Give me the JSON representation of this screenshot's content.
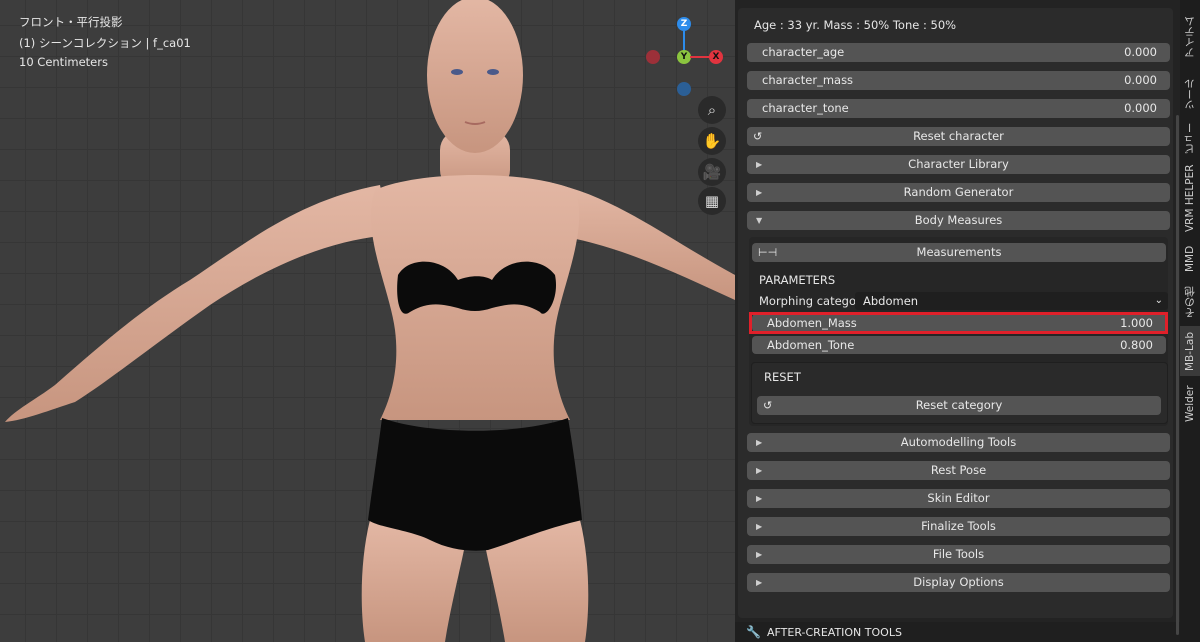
{
  "viewport": {
    "view_name": "フロント・平行投影",
    "collection": "(1) シーンコレクション | f_ca01",
    "scale": "10 Centimeters",
    "gizmo": {
      "z_label": "Z",
      "y_label": "Y",
      "x_label": "X",
      "colors": {
        "x": "#e1343f",
        "y": "#8bc53f",
        "z": "#2d8ceb"
      }
    },
    "nav_icons": [
      "zoom-icon",
      "hand-pan-icon",
      "camera-icon",
      "grid-icon"
    ]
  },
  "panel": {
    "stats": "Age : 33 yr.  Mass : 50%  Tone : 50%",
    "sliders": [
      {
        "label": "character_age",
        "value": "0.000"
      },
      {
        "label": "character_mass",
        "value": "0.000"
      },
      {
        "label": "character_tone",
        "value": "0.000"
      }
    ],
    "reset_character": "Reset character",
    "collapsed_top": [
      "Character Library",
      "Random Generator"
    ],
    "body_measures": "Body Measures",
    "measurements": "Measurements",
    "parameters_heading": "PARAMETERS",
    "morph_label": "Morphing categor..",
    "morph_value": "Abdomen",
    "params": [
      {
        "label": "Abdomen_Mass",
        "value": "1.000"
      },
      {
        "label": "Abdomen_Tone",
        "value": "0.800"
      }
    ],
    "reset_heading": "RESET",
    "reset_category": "Reset category",
    "collapsed_bottom": [
      "Automodelling Tools",
      "Rest Pose",
      "Skin Editor",
      "Finalize Tools",
      "File Tools",
      "Display Options"
    ],
    "after_creation": "AFTER-CREATION TOOLS",
    "accent_highlight": "#e0202a"
  },
  "tabs": [
    "アイテム",
    "ツール",
    "ビュー",
    "VRM HELPER",
    "MMD",
    "その他",
    "MB-Lab",
    "Welder"
  ]
}
